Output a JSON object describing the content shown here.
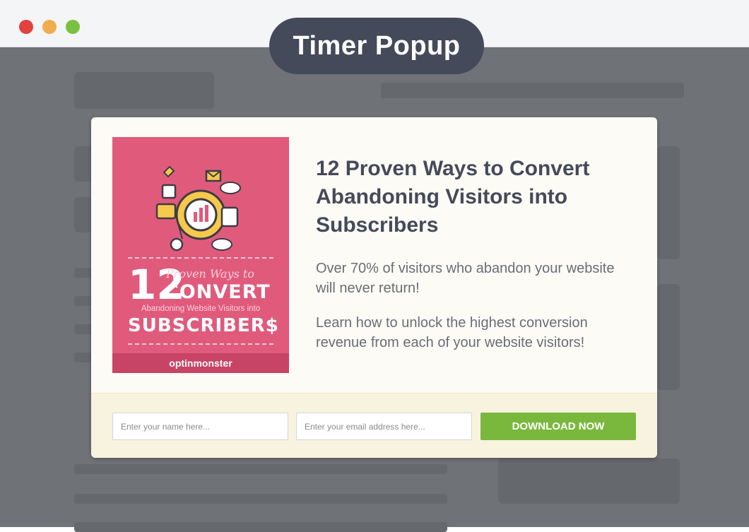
{
  "window": {
    "title": "Timer Popup",
    "controls": [
      "close",
      "minimize",
      "maximize"
    ]
  },
  "popup": {
    "book": {
      "illustration_icon": "marketing-illustration-icon",
      "number": "12",
      "proven": "Proven Ways to",
      "convert": "CONVERT",
      "abandoning": "Abandoning Website Visitors into",
      "subscribers": "SUBSCRIBER$",
      "brand": "optinmonster"
    },
    "headline": "12 Proven Ways to Convert Abandoning Visitors into Subscribers",
    "paragraph1": "Over 70% of visitors who abandon your website will never return!",
    "paragraph2": "Learn how to unlock the highest conversion revenue from each of your website visitors!",
    "form": {
      "name_placeholder": "Enter your name here...",
      "email_placeholder": "Enter your email address here...",
      "button_label": "DOWNLOAD NOW"
    }
  },
  "colors": {
    "pill_bg": "#454a5a",
    "book_bg": "#e05a7c",
    "button_bg": "#7ab83d",
    "overlay": "#6f7277"
  }
}
